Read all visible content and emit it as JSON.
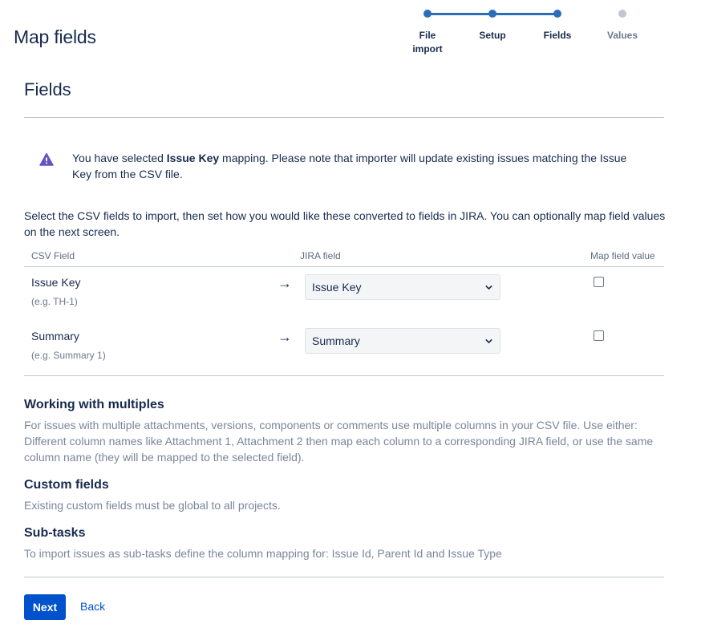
{
  "header": {
    "title": "Map fields"
  },
  "tracker": {
    "steps": [
      {
        "label": "File import",
        "state": "complete"
      },
      {
        "label": "Setup",
        "state": "complete"
      },
      {
        "label": "Fields",
        "state": "current"
      },
      {
        "label": "Values",
        "state": "todo"
      }
    ],
    "colors": {
      "done": "#2a6ebb",
      "todo": "#c1c7d0"
    }
  },
  "section": {
    "title": "Fields"
  },
  "warning": {
    "icon": "warning-icon",
    "color": "#6554c0",
    "text_before": "You have selected ",
    "text_bold": "Issue Key",
    "text_after": " mapping. Please note that importer will update existing issues matching the Issue Key from the CSV file."
  },
  "intro": "Select the CSV fields to import, then set how you would like these converted to fields in JIRA. You can optionally map field values on the next screen.",
  "table": {
    "headers": {
      "csv_field": "CSV Field",
      "jira_field": "JIRA field",
      "map_value": "Map field value"
    },
    "rows": [
      {
        "csv_field": "Issue Key",
        "example": "(e.g. TH-1)",
        "jira_field": "Issue Key",
        "map_value": false
      },
      {
        "csv_field": "Summary",
        "example": "(e.g. Summary 1)",
        "jira_field": "Summary",
        "map_value": false
      }
    ]
  },
  "help": {
    "multiples_title": "Working with multiples",
    "multiples_text": "For issues with multiple attachments, versions, components or comments use multiple columns in your CSV file. Use either: Different column names like Attachment 1, Attachment 2 then map each column to a corresponding JIRA field, or use the same column name (they will be mapped to the selected field).",
    "custom_title": "Custom fields",
    "custom_text": "Existing custom fields must be global to all projects.",
    "subtasks_title": "Sub-tasks",
    "subtasks_text": "To import issues as sub-tasks define the column mapping for: Issue Id, Parent Id and Issue Type"
  },
  "actions": {
    "next_label": "Next",
    "back_label": "Back"
  },
  "colors": {
    "primary": "#0052cc",
    "text": "#172b4d",
    "subtle": "#7a869a"
  }
}
